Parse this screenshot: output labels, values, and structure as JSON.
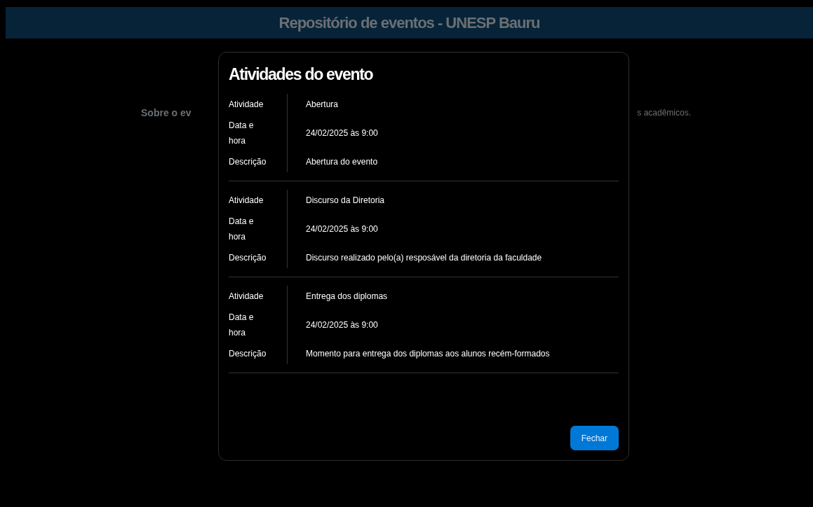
{
  "header": {
    "title": "Repositório de eventos - UNESP Bauru"
  },
  "background": {
    "left_text": "Sobre o ev",
    "right_text": "s acadêmicos."
  },
  "modal": {
    "title": "Atividades do evento",
    "activities": [
      {
        "fields": [
          {
            "label": "Atividade",
            "value": "Abertura"
          },
          {
            "label": "Data e hora",
            "value": "24/02/2025 às 9:00"
          },
          {
            "label": "Descrição",
            "value": "Abertura do evento"
          }
        ]
      },
      {
        "fields": [
          {
            "label": "Atividade",
            "value": "Discurso da Diretoria"
          },
          {
            "label": "Data e hora",
            "value": "24/02/2025 às 9:00"
          },
          {
            "label": "Descrição",
            "value": "Discurso realizado pelo(a) resposável da diretoria da faculdade"
          }
        ]
      },
      {
        "fields": [
          {
            "label": "Atividade",
            "value": "Entrega dos diplomas"
          },
          {
            "label": "Data e hora",
            "value": "24/02/2025 às 9:00"
          },
          {
            "label": "Descrição",
            "value": "Momento para entrega dos diplomas aos alunos recém-formados"
          }
        ]
      }
    ],
    "close_button": "Fechar"
  }
}
